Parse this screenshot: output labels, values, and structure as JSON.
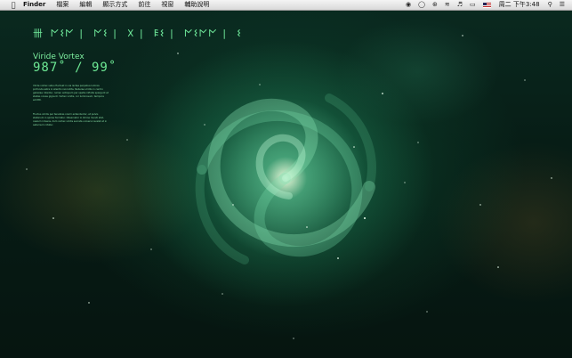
{
  "menubar": {
    "apple_icon": "apple-icon",
    "app_name": "Finder",
    "items": [
      "檔案",
      "編輯",
      "顯示方式",
      "前往",
      "視窗",
      "輔助說明"
    ],
    "status_icons": [
      "record-icon",
      "chat-icon",
      "bluetooth-icon",
      "wifi-icon",
      "volume-icon",
      "battery-icon",
      "flag-icon"
    ],
    "clock": "周二 下午3:48",
    "search_icon": "search-icon",
    "list_icon": "list-icon"
  },
  "widget": {
    "glyph_groups": [
      "卌 𐌍𐌔𐌍",
      "𐌍𐌔",
      "𐌗",
      "𐌄𐌔",
      "𐌍𐌔𐌍𐌍",
      "𐌔"
    ],
    "name": "Viride Vortex",
    "coordinates": "987˚ / 99˚",
    "paragraph_1": "Viride vortex vetus fluctuat in via lactea perpetua luminis profunda astra in silentio recondita. Nebulae viridis in centro galaxiae rotantur, lumen antiquum per spatia infinita spargunt et stellas novas gignunt. Vortex viridis, cor luminosum, tempora emittit.",
    "paragraph_2": "Fluctus viridis per tenebras cosmi extenduntur, et pulvis stellarum in spiras formatur. Observator in limine mundi stat, caelum intuens, dum vortex viridis secreta universi revelat et in aeternum rotatur."
  }
}
